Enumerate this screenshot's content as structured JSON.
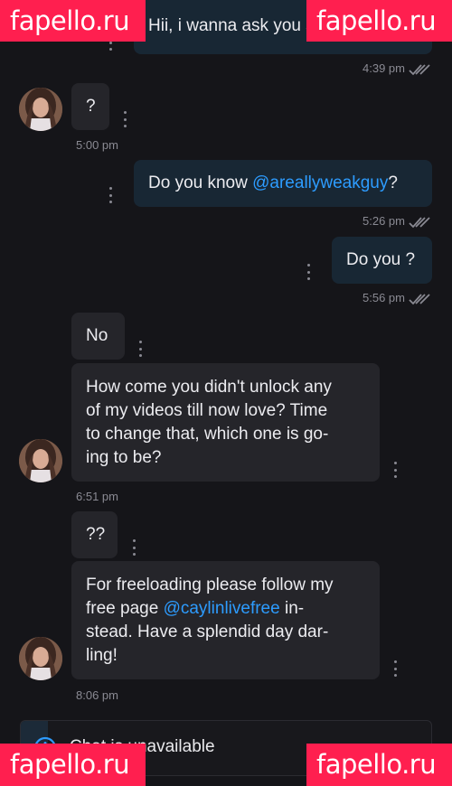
{
  "watermark": "fapello.ru",
  "messages": {
    "m0": {
      "text": "Hii, i wanna ask you something,",
      "time": "4:39 pm"
    },
    "m1": {
      "text": "?",
      "time": "5:00 pm"
    },
    "m2": {
      "before": "Do you know ",
      "mention": "@areallyweakguy",
      "after": "?",
      "time": "5:26 pm"
    },
    "m3": {
      "text": "Do you ?",
      "time": "5:56 pm"
    },
    "m4": {
      "text": "No"
    },
    "m5": {
      "lines": [
        "How come you didn't unlock any",
        "of my videos till now love? Time",
        "to change that, which one is go-",
        "ing to be?"
      ],
      "time": "6:51 pm"
    },
    "m6": {
      "text": "??"
    },
    "m7": {
      "line1": "For freeloading please follow my",
      "line2_before": "free page ",
      "line2_mention": "@caylinlivefree",
      "line2_after": " in-",
      "line3": "stead. Have a splendid day dar-",
      "line4": "ling!",
      "time": "8:06 pm"
    }
  },
  "footer": {
    "text": "Chat is unavailable",
    "icon": "info-icon"
  },
  "colors": {
    "background": "#151519",
    "incoming_bubble": "#25252a",
    "outgoing_bubble": "#182734",
    "mention": "#2d9cff",
    "watermark": "#ff1f4f"
  }
}
